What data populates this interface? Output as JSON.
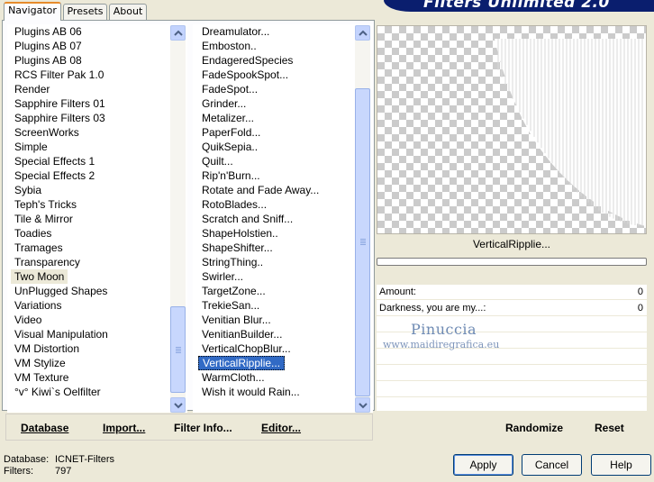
{
  "app": {
    "title": "Filters Unlimited 2.0"
  },
  "tabs": [
    "Navigator",
    "Presets",
    "About"
  ],
  "categories": {
    "items": [
      "Plugins AB 06",
      "Plugins AB 07",
      "Plugins AB 08",
      "RCS Filter Pak 1.0",
      "Render",
      "Sapphire Filters 01",
      "Sapphire Filters 03",
      "ScreenWorks",
      "Simple",
      "Special Effects 1",
      "Special Effects 2",
      "Sybia",
      "Teph's Tricks",
      "Tile & Mirror",
      "Toadies",
      "Tramages",
      "Transparency",
      "Two Moon",
      "UnPlugged Shapes",
      "Variations",
      "Video",
      "Visual Manipulation",
      "VM Distortion",
      "VM Stylize",
      "VM Texture",
      "°v° Kiwi`s Oelfilter"
    ],
    "selected": "Two Moon"
  },
  "filters": {
    "items": [
      "Dreamulator...",
      "Emboston..",
      "EndageredSpecies",
      "FadeSpookSpot...",
      "FadeSpot...",
      "Grinder...",
      "Metalizer...",
      "PaperFold...",
      "QuikSepia..",
      "Quilt...",
      "Rip'n'Burn...",
      "Rotate and Fade Away...",
      "RotoBlades...",
      "Scratch and Sniff...",
      "ShapeHolstien..",
      "ShapeShifter...",
      "StringThing..",
      "Swirler...",
      "TargetZone...",
      "TrekieSan...",
      "Venitian Blur...",
      "VenitianBuilder...",
      "VerticalChopBlur...",
      "VerticalRipplie...",
      "WarmCloth...",
      "Wish it would Rain..."
    ],
    "selected": "VerticalRipplie..."
  },
  "toolbar": {
    "database": "Database",
    "import": "Import...",
    "filter_info": "Filter Info...",
    "editor": "Editor..."
  },
  "preview": {
    "filter_name": "VerticalRipplie..."
  },
  "params": [
    {
      "label": "Amount:",
      "value": "0"
    },
    {
      "label": "Darkness, you are my...:",
      "value": "0"
    }
  ],
  "watermark": {
    "line1": "Pinuccia",
    "line2": "www.maidiregrafica.eu"
  },
  "right_buttons": {
    "randomize": "Randomize",
    "reset": "Reset"
  },
  "status": {
    "database_label": "Database:",
    "database_value": "ICNET-Filters",
    "filters_label": "Filters:",
    "filters_value": "797"
  },
  "dialog_buttons": {
    "apply": "Apply",
    "cancel": "Cancel",
    "help": "Help"
  }
}
